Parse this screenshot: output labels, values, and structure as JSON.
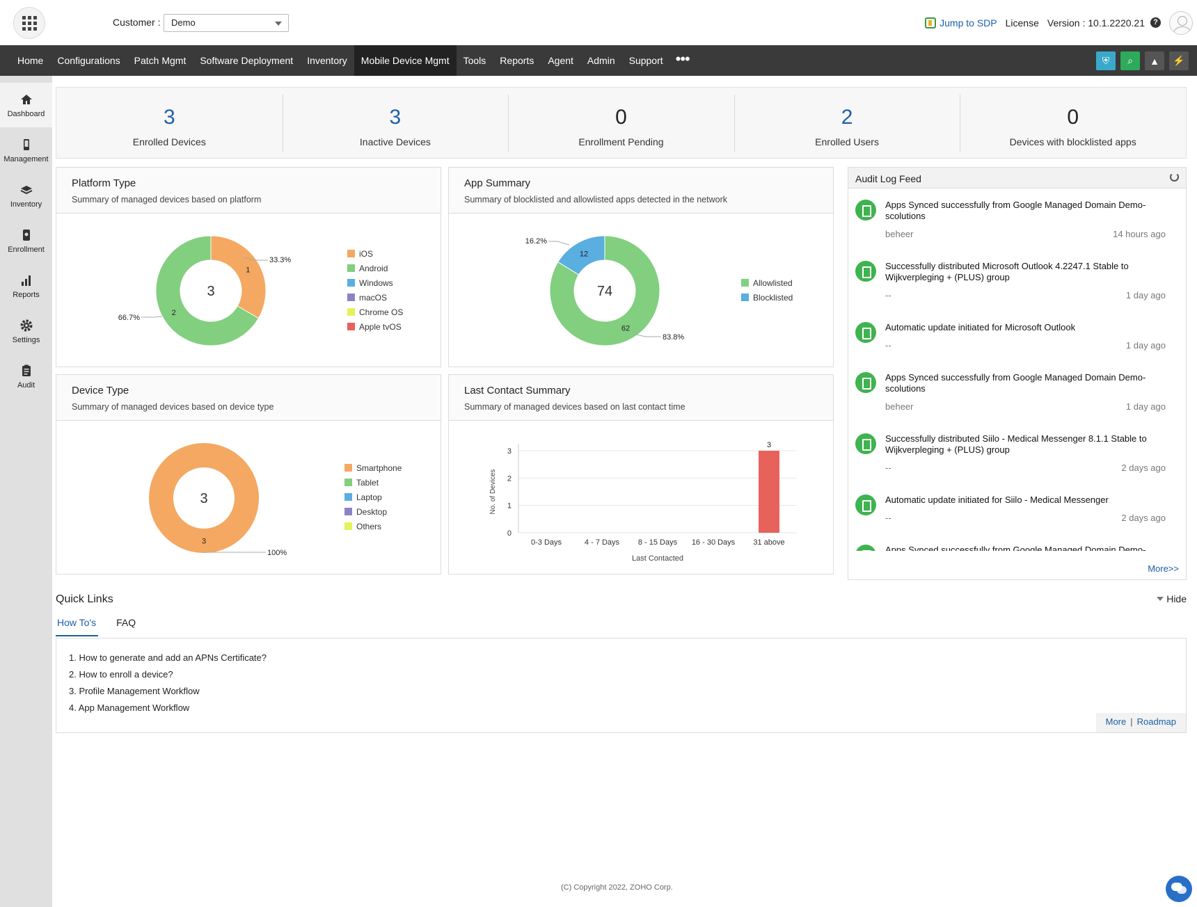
{
  "topbar": {
    "customer_label": "Customer :",
    "customer_value": "Demo",
    "jump_to_sdp": "Jump to SDP",
    "license": "License",
    "version": "Version : 10.1.2220.21",
    "help_glyph": "?"
  },
  "nav": {
    "items": [
      "Home",
      "Configurations",
      "Patch Mgmt",
      "Software Deployment",
      "Inventory",
      "Mobile Device Mgmt",
      "Tools",
      "Reports",
      "Agent",
      "Admin",
      "Support"
    ],
    "active": "Mobile Device Mgmt",
    "more_glyph": "•••",
    "right_icons": [
      {
        "name": "shield-icon",
        "color": "#3aa9c9"
      },
      {
        "name": "search-icon",
        "color": "#2eaa5b"
      },
      {
        "name": "rocket-icon",
        "color": "#555555"
      },
      {
        "name": "lightning-icon",
        "color": "#555555"
      }
    ]
  },
  "sidebar": {
    "items": [
      {
        "label": "Dashboard",
        "icon": "home-icon"
      },
      {
        "label": "Management",
        "icon": "phone-icon"
      },
      {
        "label": "Inventory",
        "icon": "layers-icon"
      },
      {
        "label": "Enrollment",
        "icon": "enroll-icon"
      },
      {
        "label": "Reports",
        "icon": "bar-chart-icon"
      },
      {
        "label": "Settings",
        "icon": "gear-icon"
      },
      {
        "label": "Audit",
        "icon": "clipboard-icon"
      }
    ]
  },
  "kpis": [
    {
      "value": "3",
      "label": "Enrolled Devices",
      "color": "#1f5fa8"
    },
    {
      "value": "3",
      "label": "Inactive Devices",
      "color": "#1f5fa8"
    },
    {
      "value": "0",
      "label": "Enrollment Pending",
      "color": "#222222"
    },
    {
      "value": "2",
      "label": "Enrolled Users",
      "color": "#1f5fa8"
    },
    {
      "value": "0",
      "label": "Devices with blocklisted apps",
      "color": "#222222"
    }
  ],
  "cards": {
    "platform": {
      "title": "Platform Type",
      "subtitle": "Summary of managed devices based on platform"
    },
    "app": {
      "title": "App Summary",
      "subtitle": "Summary of blocklisted and allowlisted apps detected in the network"
    },
    "device": {
      "title": "Device Type",
      "subtitle": "Summary of managed devices based on device type"
    },
    "contact": {
      "title": "Last Contact Summary",
      "subtitle": "Summary of managed devices based on last contact time"
    }
  },
  "chart_data": [
    {
      "type": "pie",
      "title": "Platform Type",
      "center_label": "3",
      "legend": [
        "iOS",
        "Android",
        "Windows",
        "macOS",
        "Chrome OS",
        "Apple tvOS"
      ],
      "colors": [
        "#f4a862",
        "#81cf7f",
        "#5aaee0",
        "#8a84c4",
        "#e4f25c",
        "#e8625c"
      ],
      "slices": [
        {
          "name": "iOS",
          "value": 1,
          "percent_label": "33.3%"
        },
        {
          "name": "Android",
          "value": 2,
          "percent_label": "66.7%"
        }
      ]
    },
    {
      "type": "pie",
      "title": "App Summary",
      "center_label": "74",
      "legend": [
        "Allowlisted",
        "Blocklisted"
      ],
      "colors": [
        "#81cf7f",
        "#5aaee0"
      ],
      "slices": [
        {
          "name": "Allowlisted",
          "value": 62,
          "percent_label": "83.8%"
        },
        {
          "name": "Blocklisted",
          "value": 12,
          "percent_label": "16.2%"
        }
      ]
    },
    {
      "type": "pie",
      "title": "Device Type",
      "center_label": "3",
      "legend": [
        "Smartphone",
        "Tablet",
        "Laptop",
        "Desktop",
        "Others"
      ],
      "colors": [
        "#f4a862",
        "#81cf7f",
        "#5aaee0",
        "#8a84c4",
        "#e4f25c"
      ],
      "slices": [
        {
          "name": "Smartphone",
          "value": 3,
          "percent_label": "100%"
        }
      ]
    },
    {
      "type": "bar",
      "title": "Last Contact Summary",
      "categories": [
        "0-3 Days",
        "4 - 7 Days",
        "8 - 15 Days",
        "16 - 30 Days",
        "31 above"
      ],
      "values": [
        0,
        0,
        0,
        0,
        3
      ],
      "value_labels": [
        "",
        "",
        "",
        "",
        "3"
      ],
      "xlabel": "Last Contacted",
      "ylabel": "No. of Devices",
      "ylim": [
        0,
        3
      ],
      "yticks": [
        "0",
        "1",
        "2",
        "3"
      ],
      "bar_color": "#e8625c",
      "grid": true
    }
  ],
  "audit": {
    "title": "Audit Log Feed",
    "entries": [
      {
        "text": "Apps Synced successfully from Google Managed Domain Demo-scolutions",
        "user": "beheer",
        "time": "14 hours ago"
      },
      {
        "text": "Successfully distributed Microsoft Outlook 4.2247.1 Stable to Wijkverpleging + (PLUS) group",
        "user": "--",
        "time": "1 day ago"
      },
      {
        "text": "Automatic update initiated for Microsoft Outlook",
        "user": "--",
        "time": "1 day ago"
      },
      {
        "text": "Apps Synced successfully from Google Managed Domain Demo-scolutions",
        "user": "beheer",
        "time": "1 day ago"
      },
      {
        "text": "Successfully distributed Siilo - Medical Messenger 8.1.1 Stable to Wijkverpleging + (PLUS) group",
        "user": "--",
        "time": "2 days ago"
      },
      {
        "text": "Automatic update initiated for Siilo - Medical Messenger",
        "user": "--",
        "time": "2 days ago"
      },
      {
        "text": "Apps Synced successfully from Google Managed Domain Demo-",
        "user": "",
        "time": ""
      }
    ],
    "more": "More>>"
  },
  "quick_links": {
    "title": "Quick Links",
    "hide": "Hide",
    "tabs": [
      "How To's",
      "FAQ"
    ],
    "items": [
      "1. How to generate and add an APNs Certificate?",
      "2. How to enroll a device?",
      "3. Profile Management Workflow",
      "4. App Management Workflow"
    ],
    "more": "More",
    "separator": "|",
    "roadmap": "Roadmap"
  },
  "footer": {
    "copyright": "(C) Copyright 2022, ZOHO Corp."
  }
}
